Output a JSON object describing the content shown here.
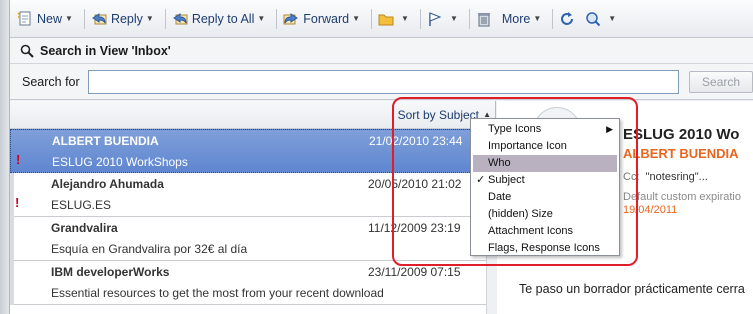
{
  "toolbar": {
    "new_label": "New",
    "reply_label": "Reply",
    "reply_all_label": "Reply to All",
    "forward_label": "Forward",
    "more_label": "More"
  },
  "search": {
    "header": "Search in View 'Inbox'",
    "label": "Search for",
    "value": "",
    "button_label": "Search"
  },
  "list": {
    "sort_label": "Sort by Subject",
    "messages": [
      {
        "from": "ALBERT BUENDIA",
        "date": "21/02/2010 23:44",
        "subject": "ESLUG 2010 WorkShops",
        "important": true,
        "selected": true
      },
      {
        "from": "Alejandro Ahumada",
        "date": "20/05/2010 21:02",
        "subject": "ESLUG.ES",
        "important": true,
        "selected": false
      },
      {
        "from": "Grandvalira",
        "date": "11/12/2009 23:19",
        "subject": "Esquía en Grandvalira por 32€ al día",
        "important": false,
        "selected": false
      },
      {
        "from": "IBM developerWorks",
        "date": "23/11/2009 07:15",
        "subject": "Essential resources to get the most from your recent download",
        "important": false,
        "selected": false
      }
    ],
    "importance_mark": "!"
  },
  "menu": {
    "items": [
      {
        "label": "Type Icons",
        "submenu": true
      },
      {
        "label": "Importance Icon"
      },
      {
        "label": "Who",
        "highlighted": true
      },
      {
        "label": "Subject",
        "checked": true
      },
      {
        "label": "Date"
      },
      {
        "label": "(hidden) Size"
      },
      {
        "label": "Attachment Icons"
      },
      {
        "label": "Flags, Response Icons"
      }
    ],
    "check_glyph": "✓",
    "submenu_glyph": "▶"
  },
  "preview": {
    "subject": "ESLUG 2010 Wo",
    "from": "ALBERT BUENDIA",
    "cc_label": "Cc",
    "cc_value": "\"notesring\"...",
    "expiration_label": "Default custom expiratio",
    "expiration_date": "19/04/2011",
    "body": "Te paso un borrador prácticamente cerra"
  },
  "colors": {
    "accent": "#1d3c6e",
    "selection": "#6a8fd4",
    "importance": "#d0021b",
    "sender_orange": "#e8661f",
    "annotation": "#e21d2a"
  }
}
